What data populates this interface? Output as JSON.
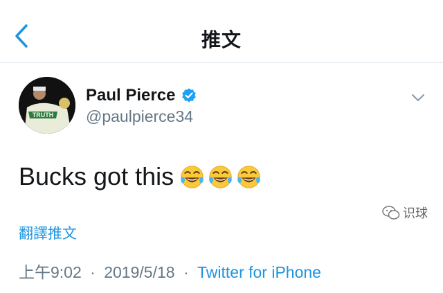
{
  "header": {
    "title": "推文",
    "back_icon": "chevron-left-icon"
  },
  "tweet": {
    "author": {
      "display_name": "Paul Pierce",
      "handle": "@paulpierce34",
      "verified": true,
      "avatar_jersey_text": "TRUTH"
    },
    "text": "Bucks got this",
    "emojis": [
      "face-with-tears-of-joy",
      "face-with-tears-of-joy",
      "face-with-tears-of-joy"
    ],
    "translate_label": "翻譯推文",
    "time": "上午9:02",
    "separator": "·",
    "date": "2019/5/18",
    "source": "Twitter for iPhone"
  },
  "watermark": {
    "label": "识球"
  },
  "colors": {
    "link": "#1b95e0",
    "secondary_text": "#657786",
    "primary_text": "#14171a",
    "divider": "#e1e8ed"
  }
}
